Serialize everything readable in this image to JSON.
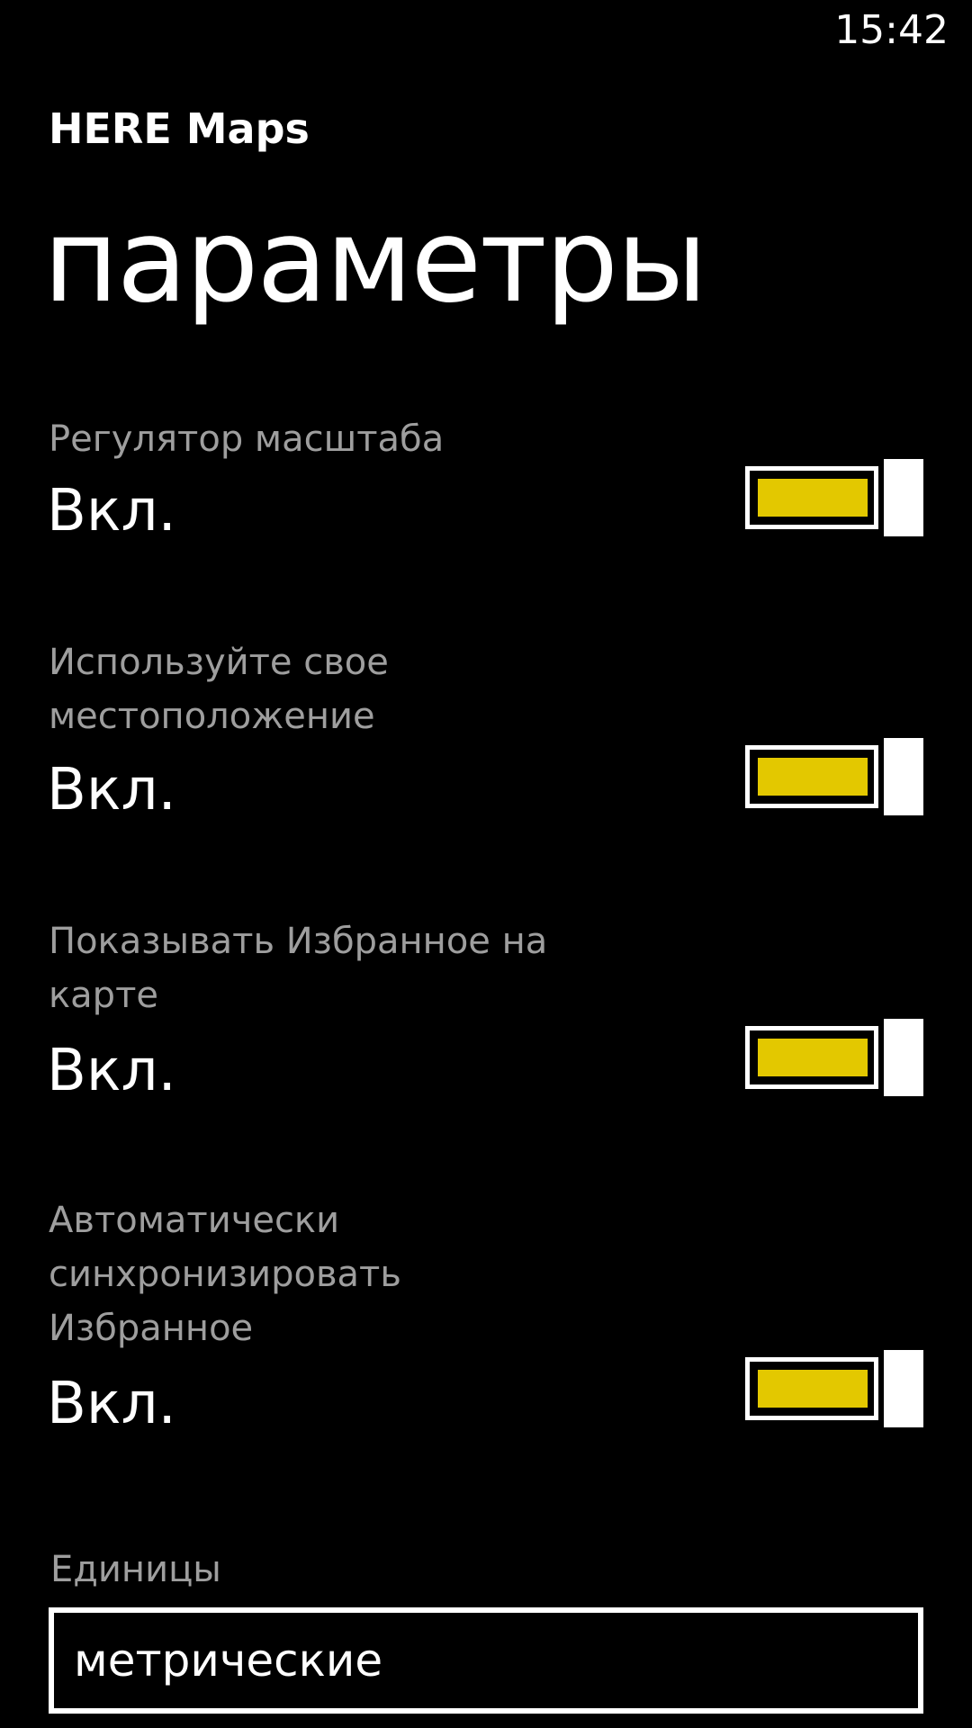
{
  "status_bar": {
    "time": "15:42"
  },
  "app": {
    "title": "HERE Maps"
  },
  "page": {
    "title": "параметры"
  },
  "settings": [
    {
      "label": "Регулятор масштаба",
      "state": "Вкл.",
      "on": true
    },
    {
      "label": "Используйте свое местоположение",
      "state": "Вкл.",
      "on": true
    },
    {
      "label": "Показывать Избранное на карте",
      "state": "Вкл.",
      "on": true
    },
    {
      "label": "Автоматически синхронизировать Избранное",
      "state": "Вкл.",
      "on": true
    }
  ],
  "units": {
    "label": "Единицы",
    "value": "метрические"
  },
  "colors": {
    "accent": "#e3c800",
    "background": "#000000",
    "label": "#9e9e9e",
    "text": "#ffffff"
  }
}
